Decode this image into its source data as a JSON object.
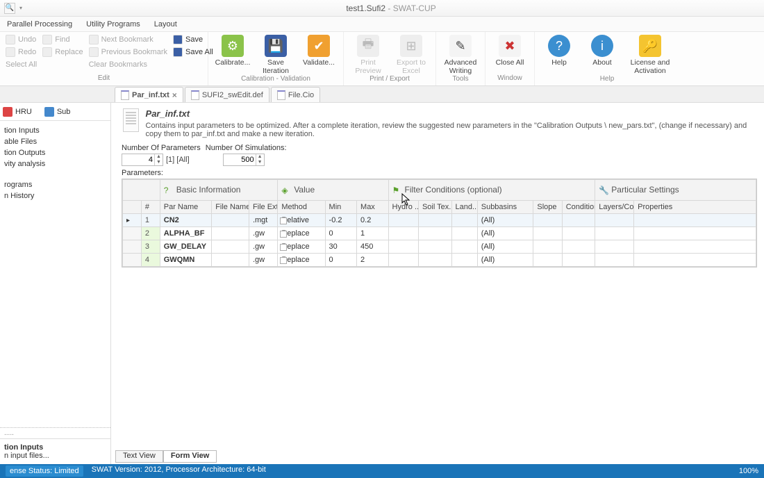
{
  "window": {
    "file": "test1.Sufi2",
    "app": "SWAT-CUP"
  },
  "ribbon_tabs": [
    "Parallel Processing",
    "Utility Programs",
    "Layout"
  ],
  "ribbon": {
    "edit": {
      "undo": "Undo",
      "redo": "Redo",
      "select_all": "Select All",
      "find": "Find",
      "replace": "Replace",
      "next_bookmark": "Next Bookmark",
      "previous_bookmark": "Previous Bookmark",
      "clear_bookmarks": "Clear Bookmarks",
      "save": "Save",
      "save_all": "Save All",
      "label": "Edit"
    },
    "calib": {
      "calibrate": "Calibrate...",
      "save_iteration": "Save Iteration",
      "validate": "Validate...",
      "label": "Calibration - Validation"
    },
    "print": {
      "print_preview": "Print Preview",
      "export_excel": "Export to Excel",
      "label": "Print / Export"
    },
    "tools": {
      "advanced_writing": "Advanced Writing",
      "label": "Tools"
    },
    "window": {
      "close_all": "Close All",
      "label": "Window"
    },
    "help": {
      "help": "Help",
      "about": "About",
      "license": "License and Activation",
      "label": "Help"
    }
  },
  "doc_tabs": [
    {
      "label": "Par_inf.txt",
      "active": true,
      "closable": true
    },
    {
      "label": "SUFI2_swEdit.def",
      "active": false,
      "closable": false
    },
    {
      "label": "File.Cio",
      "active": false,
      "closable": false
    }
  ],
  "sidebar": {
    "hru": "HRU",
    "sub": "Sub",
    "items": [
      "tion Inputs",
      "able Files",
      "tion Outputs",
      "vity analysis",
      "",
      "rograms",
      "n History"
    ],
    "footer_title": "tion Inputs",
    "footer_sub": "n input files..."
  },
  "file": {
    "title": "Par_inf.txt",
    "desc": "Contains input parameters to be optimized. After a complete iteration, review the suggested new parameters in the \"Calibration Outputs \\ new_pars.txt\", (change if necessary) and copy them to par_inf.txt and make a new iteration."
  },
  "controls": {
    "num_params_label": "Number Of Parameters",
    "num_sim_label": "Number Of Simulations:",
    "num_params": "4",
    "num_params_extra": "[1] [All]",
    "num_sim": "500",
    "params_label": "Parameters:"
  },
  "grid": {
    "groups": {
      "basic": "Basic Information",
      "value": "Value",
      "filter": "Filter Conditions (optional)",
      "particular": "Particular Settings"
    },
    "cols": {
      "hash": "#",
      "parname": "Par Name",
      "filename": "File Name",
      "fileext": "File Ext.",
      "method": "Method",
      "min": "Min",
      "max": "Max",
      "hydro": "Hydro ...",
      "soil": "Soil Tex...",
      "land": "Land...",
      "subb": "Subbasins",
      "slope": "Slope",
      "cond": "Condition...",
      "layers": "Layers/Colu...",
      "props": "Properties"
    },
    "rows": [
      {
        "n": "1",
        "par": "CN2",
        "file": "",
        "ext": ".mgt",
        "method": "Relative",
        "min": "-0.2",
        "max": "0.2",
        "subb": "(All)"
      },
      {
        "n": "2",
        "par": "ALPHA_BF",
        "file": "",
        "ext": ".gw",
        "method": "Replace",
        "min": "0",
        "max": "1",
        "subb": "(All)"
      },
      {
        "n": "3",
        "par": "GW_DELAY",
        "file": "",
        "ext": ".gw",
        "method": "Replace",
        "min": "30",
        "max": "450",
        "subb": "(All)"
      },
      {
        "n": "4",
        "par": "GWQMN",
        "file": "",
        "ext": ".gw",
        "method": "Replace",
        "min": "0",
        "max": "2",
        "subb": "(All)"
      }
    ]
  },
  "view_tabs": {
    "text": "Text View",
    "form": "Form View"
  },
  "status": {
    "license": "ense Status: Limited",
    "version": "SWAT Version: 2012, Processor Architecture: 64-bit",
    "zoom": "100%"
  }
}
